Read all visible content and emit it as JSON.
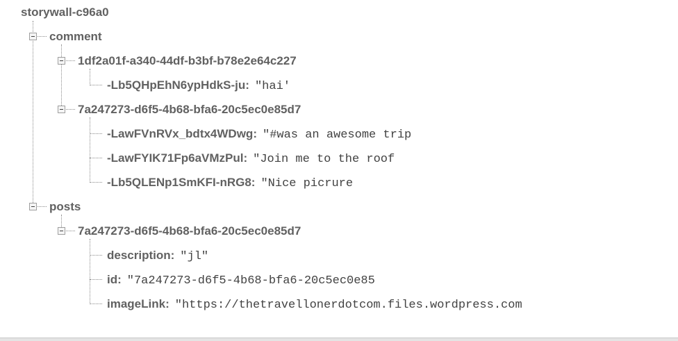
{
  "root": {
    "name": "storywall-c96a0"
  },
  "comment": {
    "key": "comment",
    "group1": {
      "key": "1df2a01f-a340-44df-b3bf-b78e2e64c227",
      "entries": [
        {
          "key": "-Lb5QHpEhN6ypHdkS-ju",
          "colon": ":",
          "value": "\"hai'"
        }
      ]
    },
    "group2": {
      "key": "7a247273-d6f5-4b68-bfa6-20c5ec0e85d7",
      "entries": [
        {
          "key": "-LawFVnRVx_bdtx4WDwg",
          "colon": ":",
          "value": "\"#was an awesome trip"
        },
        {
          "key": "-LawFYIK71Fp6aVMzPul",
          "colon": ":",
          "value": "\"Join me to the roof"
        },
        {
          "key": "-Lb5QLENp1SmKFI-nRG8",
          "colon": ":",
          "value": "\"Nice picrure"
        }
      ]
    }
  },
  "posts": {
    "key": "posts",
    "group1": {
      "key": "7a247273-d6f5-4b68-bfa6-20c5ec0e85d7",
      "entries": [
        {
          "key": "description",
          "colon": ":",
          "value": "\"jl\""
        },
        {
          "key": "id",
          "colon": ":",
          "value": "\"7a247273-d6f5-4b68-bfa6-20c5ec0e85"
        },
        {
          "key": "imageLink",
          "colon": ":",
          "value": "\"https://thetravellonerdotcom.files.wordpress.com"
        }
      ]
    }
  }
}
